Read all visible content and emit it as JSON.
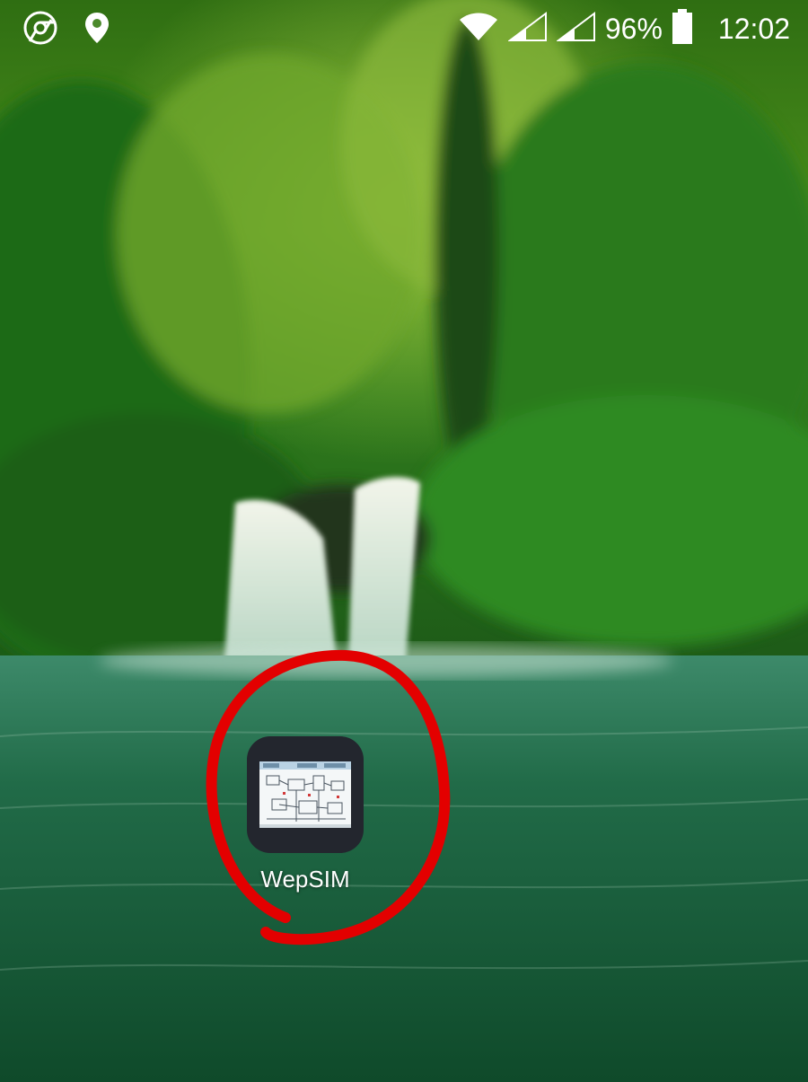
{
  "status_bar": {
    "battery_percent": "96%",
    "time": "12:02",
    "left_icons": [
      "chrome-icon",
      "location-pin-icon"
    ],
    "right_icons": [
      "wifi-icon",
      "signal-icon",
      "signal-icon",
      "battery-icon"
    ]
  },
  "home_screen": {
    "apps": [
      {
        "label": "WepSIM",
        "icon": "wepsim-app-icon"
      }
    ]
  },
  "annotation": {
    "type": "hand-drawn circle",
    "color": "#e30000"
  },
  "colors": {
    "annotation_red": "#e30000",
    "icon_background": "#23262e"
  }
}
